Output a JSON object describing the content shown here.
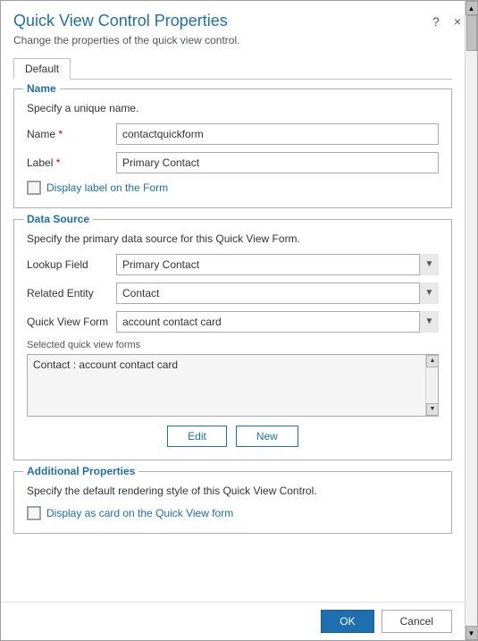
{
  "dialog": {
    "title": "Quick View Control Properties",
    "subtitle": "Change the properties of the quick view control.",
    "help_label": "?",
    "close_label": "×"
  },
  "tabs": [
    {
      "label": "Default"
    }
  ],
  "name_section": {
    "legend": "Name",
    "description": "Specify a unique name.",
    "name_label": "Name",
    "name_required": "*",
    "name_value": "contactquickform",
    "label_label": "Label",
    "label_required": "*",
    "label_value": "Primary Contact",
    "checkbox_label": "Display label on the Form"
  },
  "datasource_section": {
    "legend": "Data Source",
    "description": "Specify the primary data source for this Quick View Form.",
    "lookup_label": "Lookup Field",
    "lookup_value": "Primary Contact",
    "lookup_options": [
      "Primary Contact"
    ],
    "entity_label": "Related Entity",
    "entity_value": "Contact",
    "entity_options": [
      "Contact"
    ],
    "form_label": "Quick View Form",
    "form_value": "account contact card",
    "form_options": [
      "account contact card"
    ],
    "selected_forms_label": "Selected quick view forms",
    "selected_forms_item": "Contact : account contact card",
    "edit_btn": "Edit",
    "new_btn": "New"
  },
  "additional_section": {
    "legend": "Additional Properties",
    "description": "Specify the default rendering style of this Quick View Control.",
    "checkbox_label": "Display as card on the Quick View form"
  },
  "footer": {
    "ok_label": "OK",
    "cancel_label": "Cancel"
  },
  "scrollbar": {
    "up": "▲",
    "down": "▼"
  }
}
